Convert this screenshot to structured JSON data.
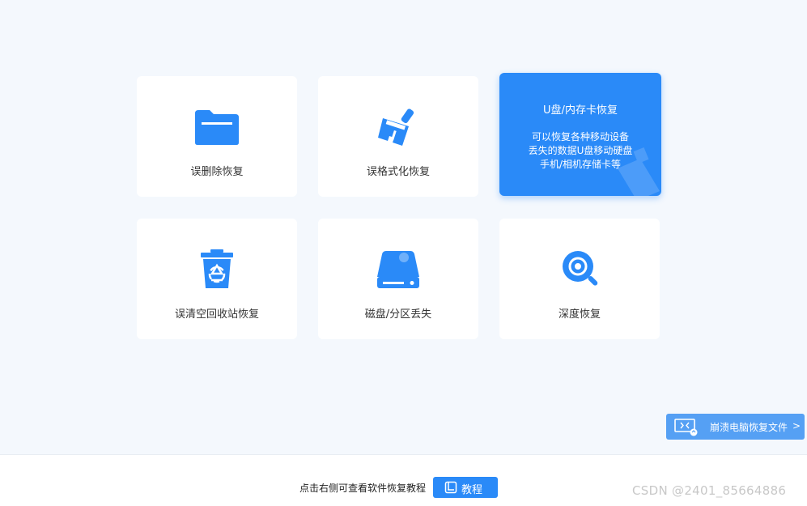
{
  "cards": [
    {
      "label": "误删除恢复",
      "icon": "folder-icon"
    },
    {
      "label": "误格式化恢复",
      "icon": "broom-icon"
    },
    {
      "title": "U盘/内存卡恢复",
      "desc": [
        "可以恢复各种移动设备",
        "丢失的数据U盘移动硬盘",
        "手机/相机存储卡等"
      ],
      "icon": "usb-card-icon",
      "active": true
    },
    {
      "label": "误清空回收站恢复",
      "icon": "recycle-bin-icon"
    },
    {
      "label": "磁盘/分区丢失",
      "icon": "hard-disk-icon"
    },
    {
      "label": "深度恢复",
      "icon": "deep-scan-icon"
    }
  ],
  "side_button": {
    "label": "崩溃电脑恢复文件",
    "chevron": ">",
    "icon": "crashed-computer-icon"
  },
  "footer": {
    "hint": "点击右侧可查看软件恢复教程",
    "tutorial_label": "教程",
    "tutorial_icon": "book-icon"
  },
  "watermark": "CSDN @2401_85664886",
  "colors": {
    "accent": "#2a8af8",
    "background": "#f4f8fd",
    "card": "#ffffff",
    "side_button": "#55a0f4"
  }
}
